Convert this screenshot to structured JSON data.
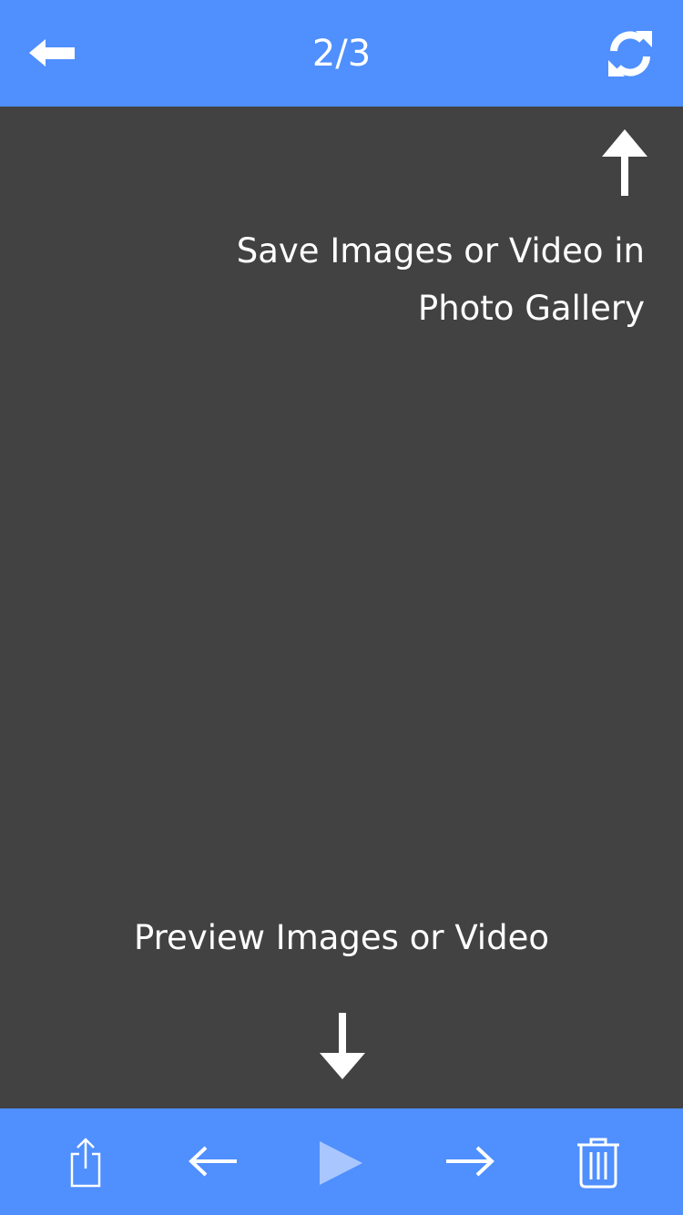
{
  "header": {
    "counter": "2/3",
    "back_icon": "back-arrow-icon",
    "refresh_icon": "refresh-icon"
  },
  "overlay": {
    "save_hint_line1": "Save Images or Video in",
    "save_hint_line2": "Photo Gallery",
    "preview_hint": "Preview Images or Video"
  },
  "toolbar": {
    "items": [
      "share-icon",
      "previous-arrow-icon",
      "play-icon",
      "next-arrow-icon",
      "trash-icon"
    ]
  },
  "colors": {
    "bar": "#4f8ffe",
    "background": "#424242",
    "foreground": "#ffffff",
    "disabled": "#a9c7fe"
  }
}
